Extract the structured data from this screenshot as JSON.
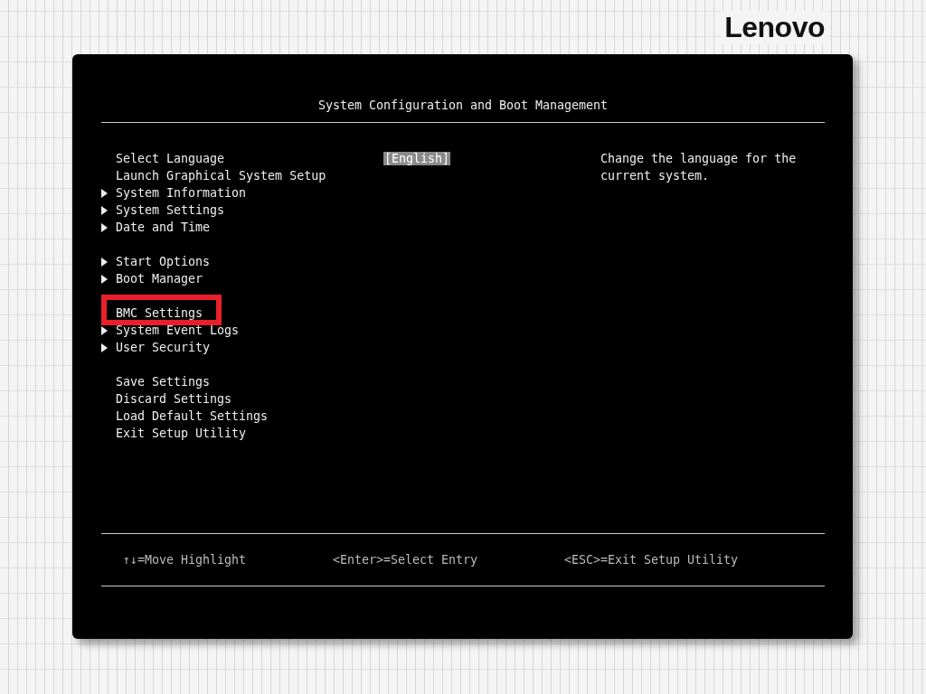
{
  "logo": "Lenovo",
  "title": "System Configuration and Boot Management",
  "menu_groups": [
    {
      "items": [
        {
          "label": "Select Language",
          "arrow": false,
          "highlighted": false,
          "value": "[English]",
          "value_selected": true
        },
        {
          "label": "Launch Graphical System Setup",
          "arrow": false,
          "highlighted": false
        },
        {
          "label": "System Information",
          "arrow": true,
          "highlighted": false
        },
        {
          "label": "System Settings",
          "arrow": true,
          "highlighted": false
        },
        {
          "label": "Date and Time",
          "arrow": true,
          "highlighted": false
        }
      ]
    },
    {
      "items": [
        {
          "label": "Start Options",
          "arrow": true,
          "highlighted": false
        },
        {
          "label": "Boot Manager",
          "arrow": true,
          "highlighted": false
        }
      ]
    },
    {
      "items": [
        {
          "label": "BMC Settings",
          "arrow": false,
          "highlighted": true
        },
        {
          "label": "System Event Logs",
          "arrow": true,
          "highlighted": false
        },
        {
          "label": "User Security",
          "arrow": true,
          "highlighted": false
        }
      ]
    },
    {
      "items": [
        {
          "label": "Save Settings",
          "arrow": false,
          "highlighted": false
        },
        {
          "label": "Discard Settings",
          "arrow": false,
          "highlighted": false
        },
        {
          "label": "Load Default Settings",
          "arrow": false,
          "highlighted": false
        },
        {
          "label": "Exit Setup Utility",
          "arrow": false,
          "highlighted": false
        }
      ]
    }
  ],
  "help_text": "Change the language for the current system.",
  "footer": [
    "↑↓=Move Highlight",
    "<Enter>=Select Entry",
    "<ESC>=Exit Setup Utility"
  ]
}
